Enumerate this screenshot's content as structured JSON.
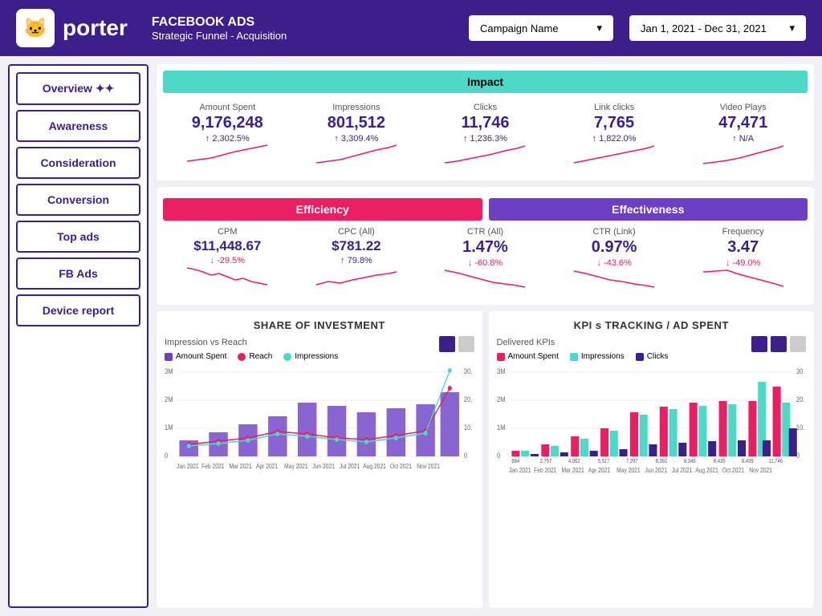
{
  "header": {
    "logo_text": "porter",
    "title_main": "FACEBOOK ADS",
    "title_sub": "Strategic Funnel - Acquisition",
    "campaign_label": "Campaign Name",
    "date_label": "Jan 1, 2021 - Dec 31, 2021"
  },
  "sidebar": {
    "items": [
      {
        "label": "Overview ✦✦",
        "id": "overview"
      },
      {
        "label": "Awareness",
        "id": "awareness"
      },
      {
        "label": "Consideration",
        "id": "consideration"
      },
      {
        "label": "Conversion",
        "id": "conversion"
      },
      {
        "label": "Top ads",
        "id": "top-ads"
      },
      {
        "label": "FB Ads",
        "id": "fb-ads"
      },
      {
        "label": "Device report",
        "id": "device-report"
      }
    ]
  },
  "impact": {
    "title": "Impact",
    "metrics": [
      {
        "label": "Amount Spent",
        "value": "9,176,248",
        "change": "↑ 2,302.5%",
        "dir": "up"
      },
      {
        "label": "Impressions",
        "value": "801,512",
        "change": "↑ 3,309.4%",
        "dir": "up"
      },
      {
        "label": "Clicks",
        "value": "11,746",
        "change": "↑ 1,236.3%",
        "dir": "up"
      },
      {
        "label": "Link clicks",
        "value": "7,765",
        "change": "↑ 1,822.0%",
        "dir": "up"
      },
      {
        "label": "Video Plays",
        "value": "47,471",
        "change": "↑ N/A",
        "dir": "up"
      }
    ]
  },
  "efficiency_label": "Efficiency",
  "effectiveness_label": "Effectiveness",
  "efficiency": {
    "metrics": [
      {
        "label": "CPM",
        "prefix": "$",
        "value": "11,448.67",
        "change": "↓ -29.5%",
        "dir": "down"
      },
      {
        "label": "CPC (All)",
        "prefix": "$",
        "value": "781.22",
        "change": "↑ 79.8%",
        "dir": "up"
      },
      {
        "label": "CTR (All)",
        "value": "1.47%",
        "change": "↓ -60.8%",
        "dir": "down"
      },
      {
        "label": "CTR (Link)",
        "value": "0.97%",
        "change": "↓ -43.6%",
        "dir": "down"
      },
      {
        "label": "Frequency",
        "value": "3.47",
        "change": "↓ -49.0%",
        "dir": "down"
      }
    ]
  },
  "chart_left": {
    "title": "SHARE OF INVESTMENT",
    "subtitle": "Impression vs Reach",
    "legend": [
      {
        "label": "Amount Spent",
        "color": "#6c3fc5"
      },
      {
        "label": "Reach",
        "color": "#e91e63",
        "type": "line"
      },
      {
        "label": "Impressions",
        "color": "#4dd9c8",
        "type": "line"
      }
    ],
    "months": [
      "Jan 2021",
      "Feb 2021",
      "Mar 2021",
      "Apr 2021",
      "May 2021",
      "Jun 2021",
      "Jul 2021",
      "Aug 2021",
      "Oct 2021",
      "Nov 2021"
    ],
    "bars": [
      350,
      500,
      700,
      900,
      1200,
      1100,
      950,
      1050,
      1150,
      1400
    ],
    "reach_line": [
      200,
      250,
      300,
      400,
      350,
      300,
      280,
      320,
      400,
      1200
    ],
    "impressions_line": [
      180,
      220,
      280,
      380,
      300,
      260,
      240,
      300,
      380,
      2800
    ]
  },
  "chart_right": {
    "title": "KPI s TRACKING / AD SPENT",
    "subtitle": "Delivered KPIs",
    "legend": [
      {
        "label": "Amount Spent",
        "color": "#e91e63"
      },
      {
        "label": "Impressions",
        "color": "#4dd9c8"
      },
      {
        "label": "Clicks",
        "color": "#3d1f8c"
      }
    ],
    "months": [
      "Jan 2021",
      "Feb 2021",
      "Mar 2021",
      "Apr 2021",
      "May 2021",
      "Jun 2021",
      "Jul 2021",
      "Aug 2021",
      "Oct 2021",
      "Nov 2021"
    ],
    "values": [
      684,
      2757,
      4062,
      5517,
      7297,
      8081,
      8346,
      8435,
      8439,
      11746
    ]
  }
}
